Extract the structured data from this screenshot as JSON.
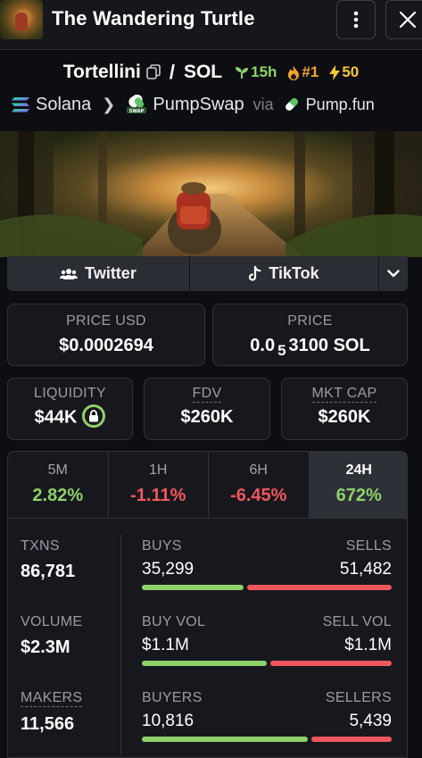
{
  "header": {
    "title": "The Wandering Turtle",
    "more_icon": "vertical-dots-icon",
    "close_icon": "close-icon"
  },
  "pair": {
    "token": "Tortellini",
    "separator": "/",
    "quote": "SOL",
    "age": "15h",
    "rank": "#1",
    "boosts": "50",
    "copy_icon": "copy-icon"
  },
  "chain": {
    "network": "Solana",
    "dex": "PumpSwap",
    "via": "via",
    "launchpad": "Pump.fun"
  },
  "social": {
    "twitter": "Twitter",
    "tiktok": "TikTok"
  },
  "price": {
    "usd_label": "PRICE USD",
    "usd_value": "$0.0002694",
    "native_label": "PRICE",
    "native_prefix": "0.0",
    "native_subscript": "5",
    "native_rest": "3100 SOL"
  },
  "metrics": {
    "liquidity_label": "LIQUIDITY",
    "liquidity_value": "$44K",
    "fdv_label": "FDV",
    "fdv_value": "$260K",
    "mktcap_label": "MKT CAP",
    "mktcap_value": "$260K"
  },
  "timeframes": [
    {
      "label": "5M",
      "value": "2.82%",
      "direction": "up"
    },
    {
      "label": "1H",
      "value": "-1.11%",
      "direction": "down"
    },
    {
      "label": "6H",
      "value": "-6.45%",
      "direction": "down"
    },
    {
      "label": "24H",
      "value": "672%",
      "direction": "up",
      "active": true
    }
  ],
  "stats": {
    "txns_label": "TXNS",
    "txns_value": "86,781",
    "volume_label": "VOLUME",
    "volume_value": "$2.3M",
    "makers_label": "MAKERS",
    "makers_value": "11,566",
    "buys_label": "BUYS",
    "buys_value": "35,299",
    "sells_label": "SELLS",
    "sells_value": "51,482",
    "buys_fraction": 0.407,
    "buyvol_label": "BUY VOL",
    "buyvol_value": "$1.1M",
    "sellvol_label": "SELL VOL",
    "sellvol_value": "$1.1M",
    "buyvol_fraction": 0.5,
    "buyers_label": "BUYERS",
    "buyers_value": "10,816",
    "sellers_label": "SELLERS",
    "sellers_value": "5,439",
    "buyers_fraction": 0.665
  },
  "colors": {
    "positive": "#8ed16a",
    "negative": "#f0575d",
    "rank": "#f2a52e",
    "boost": "#f5c83a"
  }
}
